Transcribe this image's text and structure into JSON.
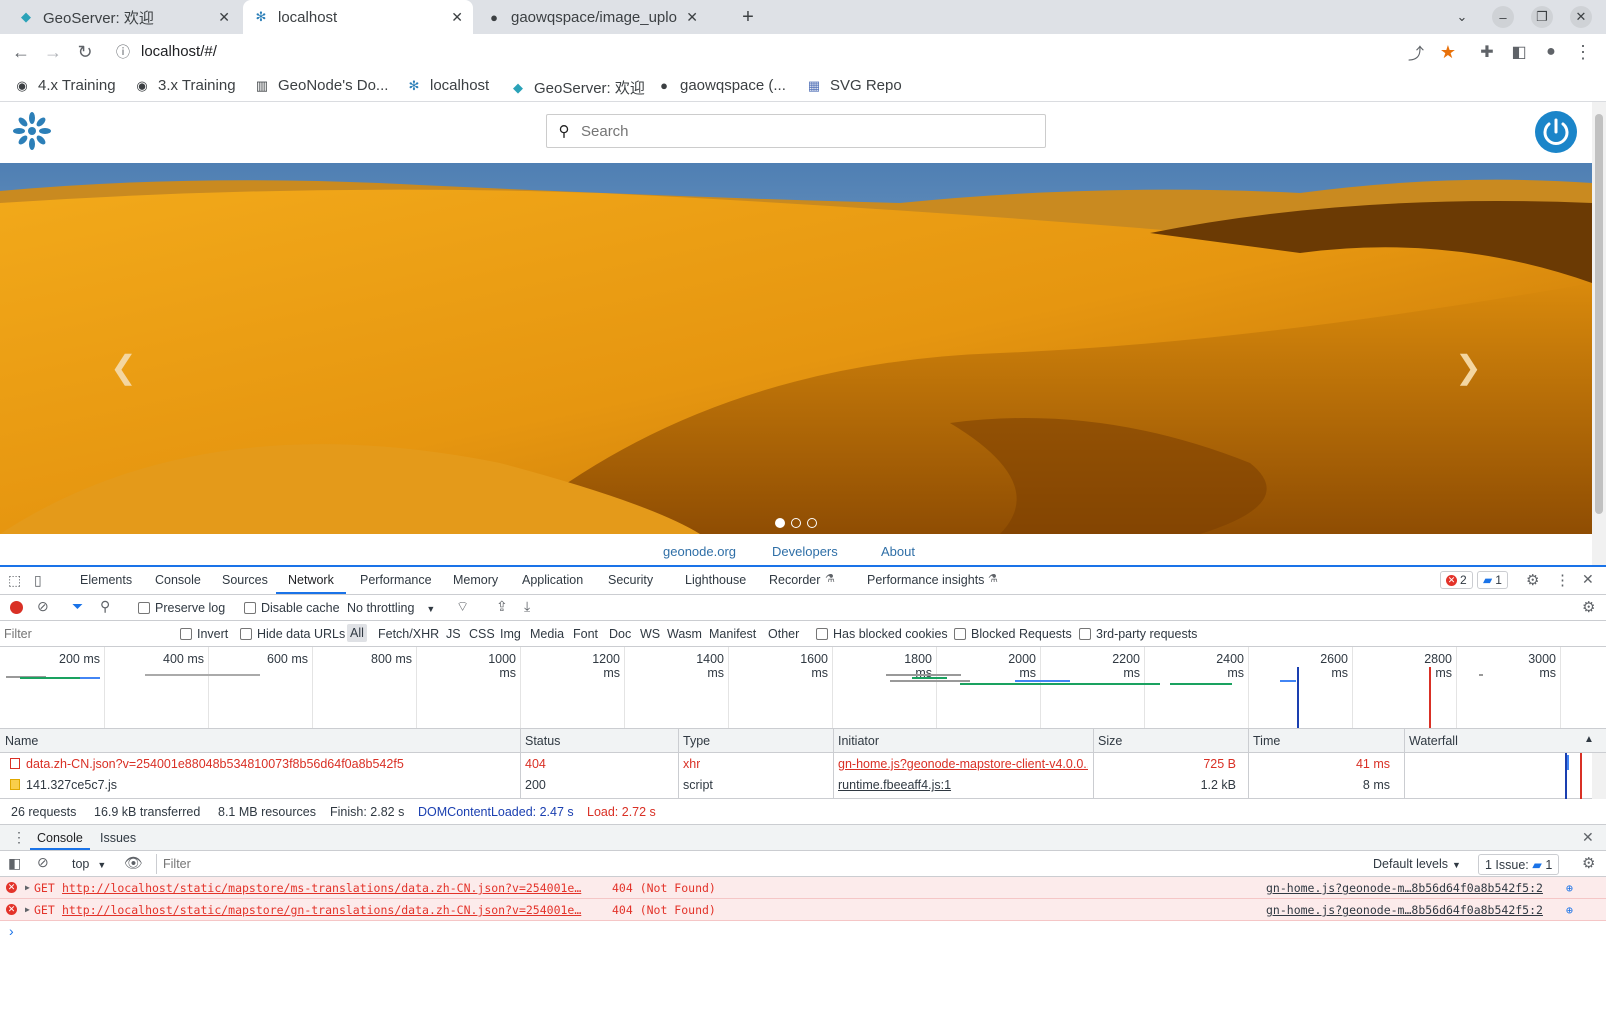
{
  "tabs": [
    {
      "title": "GeoServer: 欢迎",
      "icon": "geoserver-icon"
    },
    {
      "title": "localhost",
      "icon": "geonode-icon"
    },
    {
      "title": "gaowqspace/image_uplo",
      "icon": "github-icon"
    }
  ],
  "address": {
    "url": "localhost/#/"
  },
  "bookmarks": [
    {
      "label": "4.x Training",
      "icon": "globe-icon"
    },
    {
      "label": "3.x Training",
      "icon": "globe-icon"
    },
    {
      "label": "GeoNode's Do...",
      "icon": "doc-icon"
    },
    {
      "label": "localhost",
      "icon": "geonode-icon"
    },
    {
      "label": "GeoServer: 欢迎",
      "icon": "geoserver-icon"
    },
    {
      "label": "gaowqspace (...",
      "icon": "github-icon"
    },
    {
      "label": "SVG Repo",
      "icon": "svgrepo-icon"
    }
  ],
  "site": {
    "search_placeholder": "Search",
    "footer_links": [
      "geonode.org",
      "Developers",
      "About"
    ]
  },
  "devtools": {
    "tabs": [
      "Elements",
      "Console",
      "Sources",
      "Network",
      "Performance",
      "Memory",
      "Application",
      "Security",
      "Lighthouse",
      "Recorder",
      "Performance insights"
    ],
    "badges": {
      "errors": "2",
      "messages": "1"
    },
    "network_bar": {
      "preserve_log": "Preserve log",
      "disable_cache": "Disable cache",
      "throttling": "No throttling"
    },
    "filter": {
      "placeholder": "Filter",
      "invert": "Invert",
      "hide_data_urls": "Hide data URLs",
      "types": [
        "All",
        "Fetch/XHR",
        "JS",
        "CSS",
        "Img",
        "Media",
        "Font",
        "Doc",
        "WS",
        "Wasm",
        "Manifest",
        "Other"
      ],
      "has_blocked_cookies": "Has blocked cookies",
      "blocked_requests": "Blocked Requests",
      "third_party": "3rd-party requests"
    },
    "timeline_ticks": [
      "200 ms",
      "400 ms",
      "600 ms",
      "800 ms",
      "1000 ms",
      "1200 ms",
      "1400 ms",
      "1600 ms",
      "1800 ms",
      "2000 ms",
      "2200 ms",
      "2400 ms",
      "2600 ms",
      "2800 ms",
      "3000 ms"
    ],
    "columns": [
      "Name",
      "Status",
      "Type",
      "Initiator",
      "Size",
      "Time",
      "Waterfall"
    ],
    "requests": [
      {
        "name": "data.zh-CN.json?v=254001e88048b534810073f8b56d64f0a8b542f5",
        "status": "404",
        "type": "xhr",
        "initiator": "gn-home.js?geonode-mapstore-client-v4.0.0...",
        "size": "725 B",
        "time": "41 ms",
        "error": true
      },
      {
        "name": "141.327ce5c7.js",
        "status": "200",
        "type": "script",
        "initiator": "runtime.fbeeaff4.js:1",
        "size": "1.2 kB",
        "time": "8 ms",
        "error": false
      }
    ],
    "summary": {
      "requests": "26 requests",
      "transferred": "16.9 kB transferred",
      "resources": "8.1 MB resources",
      "finish": "Finish: 2.82 s",
      "dom_loaded": "DOMContentLoaded: 2.47 s",
      "load": "Load: 2.72 s"
    },
    "drawer_tabs": [
      "Console",
      "Issues"
    ],
    "console": {
      "context": "top",
      "filter_placeholder": "Filter",
      "levels": "Default levels",
      "issues": "1 Issue:",
      "issues_count": "1",
      "messages": [
        {
          "method": "GET",
          "url": "http://localhost/static/mapstore/ms-translations/data.zh-CN.json?v=254001e…",
          "status": "404 (Not Found)",
          "source": "gn-home.js?geonode-m…8b56d64f0a8b542f5:2"
        },
        {
          "method": "GET",
          "url": "http://localhost/static/mapstore/gn-translations/data.zh-CN.json?v=254001e…",
          "status": "404 (Not Found)",
          "source": "gn-home.js?geonode-m…8b56d64f0a8b542f5:2"
        }
      ],
      "prompt": "›"
    }
  }
}
